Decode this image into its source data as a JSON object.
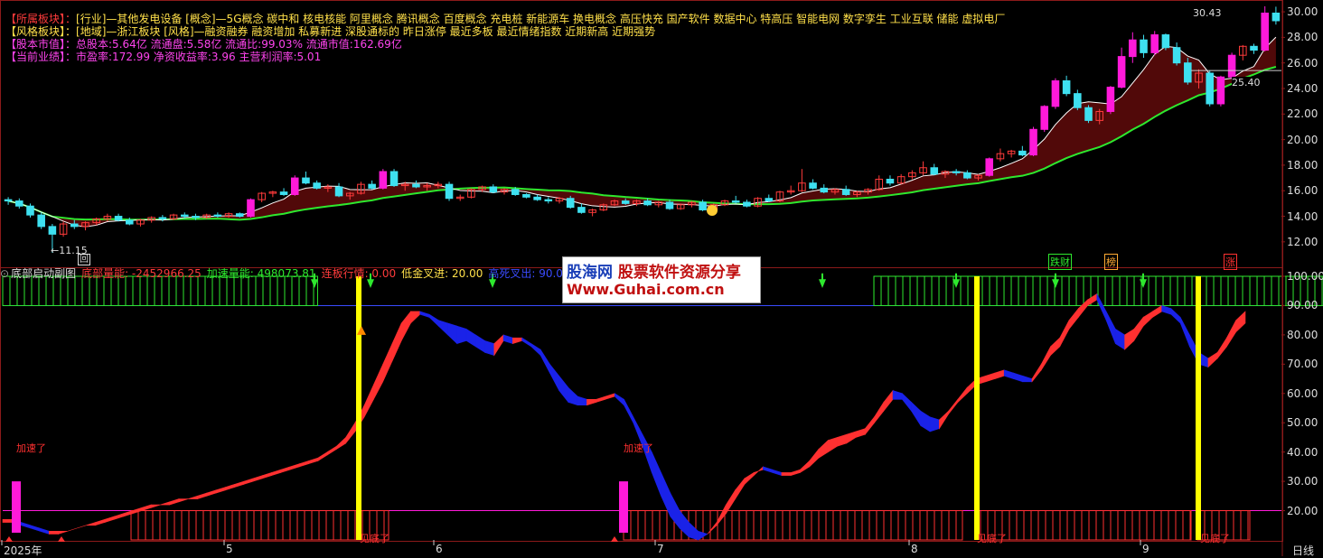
{
  "info": {
    "sector_key": "【所属板块】：",
    "sector_val": "[行业]—其他发电设备 [概念]—5G概念 碳中和 核电核能 阿里概念 腾讯概念 百度概念 充电桩 新能源车 换电概念 高压快充 国产软件 数据中心 特高压 智能电网 数字孪生 工业互联 储能 虚拟电厂",
    "style_key": "【风格板块】：",
    "style_val": "[地域]—浙江板块 [风格]—融资融券 融资增加 私募新进 深股通标的 昨日涨停 最近多板 最近情绪指数 近期新高 近期强势",
    "equity_key": "【股本市值】：",
    "equity_val": "总股本:5.64亿 流通盘:5.58亿 流通比:99.03% 流通市值:162.69亿",
    "perf_key": "【当前业绩】：",
    "perf_val": "市盈率:172.99 净资收益率:3.96 主营利润率:5.01"
  },
  "colors": {
    "up": "#ff3b3b",
    "down": "#3ee0f0",
    "magenta": "#ff1ad9",
    "green_line": "#2ee82e",
    "white_line": "#ffffff",
    "fill_red": "#5a0a0a",
    "fill_green": "#0f5a1a",
    "grid": "#8b1a1a",
    "osc_red": "#ff3030",
    "osc_blue": "#1a22e8",
    "yellow": "#ffff00"
  },
  "main_axis": {
    "labels": [
      "30.00",
      "28.00",
      "26.00",
      "24.00",
      "22.00",
      "20.00",
      "18.00",
      "16.00",
      "14.00",
      "12.00"
    ]
  },
  "main_annotations": {
    "high": "30.43",
    "low": "←11.15",
    "last": "25.40",
    "box": "回"
  },
  "badges": [
    {
      "label": "跌财",
      "color": "#2ee82e"
    },
    {
      "label": "榜",
      "color": "#ffaa33"
    },
    {
      "label": "涨",
      "color": "#ff3030"
    }
  ],
  "indicator_header": {
    "name": "底部启动副图",
    "energy": "底部量能: -2452966.25",
    "accel": "加速量能: 498073.81",
    "board": "连板行情: 0.00",
    "golden": "低金叉进: 20.00",
    "cross": "高死叉出: 90.00"
  },
  "sub_axis": {
    "labels": [
      "100.00",
      "90.00",
      "80.00",
      "70.00",
      "60.00",
      "50.00",
      "40.00",
      "30.00",
      "20.00"
    ]
  },
  "sub_labels": {
    "accel": "加速了",
    "bottom": "见底了"
  },
  "x_labels": [
    "2025年",
    "5",
    "6",
    "7",
    "8",
    "9"
  ],
  "period": "日线",
  "watermark": {
    "brand": "股海网",
    "slogan": "股票软件资源分享",
    "url": "Www.Guhai.com.cn"
  },
  "chart_data": {
    "type": "candlestick",
    "title": "",
    "ylim": [
      11,
      30.5
    ],
    "candles": [
      [
        15.3,
        15.5,
        14.9,
        15.2
      ],
      [
        15.2,
        15.4,
        14.6,
        14.8
      ],
      [
        14.8,
        15.0,
        13.9,
        14.1
      ],
      [
        14.1,
        14.3,
        13.0,
        13.2
      ],
      [
        13.2,
        13.4,
        11.15,
        12.6
      ],
      [
        12.6,
        13.6,
        12.4,
        13.4
      ],
      [
        13.4,
        13.7,
        13.0,
        13.2
      ],
      [
        13.2,
        13.6,
        12.9,
        13.5
      ],
      [
        13.5,
        13.9,
        13.3,
        13.8
      ],
      [
        13.8,
        14.2,
        13.6,
        14.0
      ],
      [
        14.0,
        14.2,
        13.6,
        13.7
      ],
      [
        13.7,
        13.9,
        13.3,
        13.4
      ],
      [
        13.4,
        13.8,
        13.2,
        13.7
      ],
      [
        13.7,
        14.0,
        13.5,
        13.9
      ],
      [
        13.9,
        14.1,
        13.6,
        13.8
      ],
      [
        13.8,
        14.2,
        13.7,
        14.1
      ],
      [
        14.1,
        14.3,
        13.8,
        14.0
      ],
      [
        14.0,
        14.2,
        13.7,
        13.9
      ],
      [
        13.9,
        14.2,
        13.8,
        14.1
      ],
      [
        14.1,
        14.3,
        13.9,
        14.0
      ],
      [
        14.0,
        14.3,
        13.9,
        14.2
      ],
      [
        14.2,
        14.3,
        13.9,
        14.0
      ],
      [
        14.0,
        15.4,
        13.9,
        15.3
      ],
      [
        15.3,
        15.9,
        15.1,
        15.8
      ],
      [
        15.8,
        16.0,
        15.5,
        15.9
      ],
      [
        15.9,
        16.2,
        15.6,
        15.7
      ],
      [
        15.7,
        17.2,
        15.6,
        17.0
      ],
      [
        17.0,
        17.5,
        16.5,
        16.6
      ],
      [
        16.6,
        16.8,
        16.1,
        16.2
      ],
      [
        16.2,
        16.5,
        15.9,
        16.3
      ],
      [
        16.3,
        16.6,
        15.5,
        15.6
      ],
      [
        15.6,
        15.9,
        15.3,
        15.8
      ],
      [
        15.8,
        16.7,
        15.7,
        16.5
      ],
      [
        16.5,
        16.8,
        16.1,
        16.2
      ],
      [
        16.2,
        17.7,
        16.1,
        17.5
      ],
      [
        17.5,
        17.7,
        16.3,
        16.4
      ],
      [
        16.4,
        16.7,
        16.0,
        16.5
      ],
      [
        16.5,
        16.8,
        16.2,
        16.3
      ],
      [
        16.3,
        16.6,
        16.0,
        16.4
      ],
      [
        16.4,
        16.7,
        16.2,
        16.5
      ],
      [
        16.5,
        16.7,
        15.2,
        15.4
      ],
      [
        15.4,
        15.7,
        15.2,
        15.5
      ],
      [
        15.5,
        16.2,
        15.4,
        16.1
      ],
      [
        16.1,
        16.4,
        15.9,
        16.3
      ],
      [
        16.3,
        16.5,
        15.8,
        15.9
      ],
      [
        15.9,
        16.2,
        15.7,
        16.1
      ],
      [
        16.1,
        16.3,
        15.6,
        15.7
      ],
      [
        15.7,
        15.8,
        15.4,
        15.5
      ],
      [
        15.5,
        15.7,
        15.2,
        15.3
      ],
      [
        15.3,
        15.5,
        15.0,
        15.2
      ],
      [
        15.2,
        15.5,
        15.0,
        15.4
      ],
      [
        15.4,
        15.6,
        14.6,
        14.7
      ],
      [
        14.7,
        15.0,
        14.2,
        14.3
      ],
      [
        14.3,
        14.6,
        14.0,
        14.5
      ],
      [
        14.5,
        15.0,
        14.4,
        14.9
      ],
      [
        14.9,
        15.3,
        14.8,
        15.2
      ],
      [
        15.2,
        15.4,
        14.9,
        15.0
      ],
      [
        15.0,
        15.3,
        14.8,
        15.2
      ],
      [
        15.2,
        15.4,
        14.8,
        14.9
      ],
      [
        14.9,
        15.2,
        14.7,
        15.1
      ],
      [
        15.1,
        15.3,
        14.5,
        14.6
      ],
      [
        14.6,
        15.0,
        14.5,
        14.9
      ],
      [
        14.9,
        15.2,
        14.7,
        15.1
      ],
      [
        15.1,
        15.3,
        14.4,
        14.5
      ],
      [
        14.5,
        15.0,
        14.4,
        14.9
      ],
      [
        14.9,
        15.3,
        14.8,
        15.2
      ],
      [
        15.2,
        15.6,
        15.0,
        15.1
      ],
      [
        15.1,
        15.3,
        14.7,
        14.8
      ],
      [
        14.8,
        15.5,
        14.7,
        15.4
      ],
      [
        15.4,
        15.7,
        15.1,
        15.2
      ],
      [
        15.2,
        16.0,
        15.1,
        15.9
      ],
      [
        15.9,
        16.4,
        15.7,
        16.0
      ],
      [
        16.0,
        17.7,
        15.9,
        16.6
      ],
      [
        16.6,
        16.9,
        16.1,
        16.2
      ],
      [
        16.2,
        16.5,
        15.8,
        15.9
      ],
      [
        15.9,
        16.2,
        15.7,
        16.1
      ],
      [
        16.1,
        16.4,
        15.6,
        15.7
      ],
      [
        15.7,
        16.0,
        15.5,
        15.9
      ],
      [
        15.9,
        16.2,
        15.7,
        16.1
      ],
      [
        16.1,
        17.2,
        16.0,
        16.9
      ],
      [
        16.9,
        17.2,
        16.4,
        16.6
      ],
      [
        16.6,
        17.3,
        16.5,
        17.1
      ],
      [
        17.1,
        17.6,
        16.9,
        17.4
      ],
      [
        17.4,
        18.3,
        17.2,
        17.8
      ],
      [
        17.8,
        18.1,
        17.2,
        17.3
      ],
      [
        17.3,
        17.6,
        17.0,
        17.5
      ],
      [
        17.5,
        17.7,
        17.2,
        17.4
      ],
      [
        17.4,
        17.6,
        16.9,
        17.0
      ],
      [
        17.0,
        17.3,
        16.8,
        17.2
      ],
      [
        17.2,
        18.6,
        17.1,
        18.5
      ],
      [
        18.5,
        19.3,
        18.3,
        18.9
      ],
      [
        18.9,
        19.2,
        18.6,
        19.1
      ],
      [
        19.1,
        19.5,
        18.7,
        18.8
      ],
      [
        18.8,
        21.0,
        18.7,
        20.8
      ],
      [
        20.8,
        22.7,
        20.6,
        22.6
      ],
      [
        22.6,
        24.8,
        22.4,
        24.6
      ],
      [
        24.6,
        25.0,
        23.4,
        23.6
      ],
      [
        23.6,
        23.9,
        22.3,
        22.5
      ],
      [
        22.5,
        22.7,
        21.3,
        21.5
      ],
      [
        21.5,
        22.4,
        21.2,
        22.2
      ],
      [
        22.2,
        24.2,
        22.0,
        24.1
      ],
      [
        24.1,
        27.2,
        24.0,
        26.5
      ],
      [
        26.5,
        28.4,
        26.0,
        27.8
      ],
      [
        27.8,
        28.2,
        26.4,
        26.8
      ],
      [
        26.8,
        28.5,
        26.6,
        28.2
      ],
      [
        28.2,
        28.3,
        27.0,
        27.2
      ],
      [
        27.2,
        27.6,
        25.8,
        26.0
      ],
      [
        26.0,
        26.4,
        24.3,
        24.5
      ],
      [
        24.5,
        25.5,
        24.0,
        25.2
      ],
      [
        25.2,
        25.4,
        22.6,
        22.8
      ],
      [
        22.8,
        25.0,
        22.6,
        24.9
      ],
      [
        24.9,
        26.8,
        24.7,
        26.6
      ],
      [
        26.6,
        27.4,
        26.2,
        27.3
      ],
      [
        27.3,
        27.5,
        26.7,
        27.0
      ],
      [
        27.0,
        30.43,
        26.9,
        29.9
      ],
      [
        29.9,
        30.4,
        29.0,
        29.3
      ]
    ],
    "osc_a": [
      16,
      16,
      15,
      14,
      13,
      12,
      12,
      13,
      14,
      15,
      16,
      17,
      18,
      19,
      20,
      21,
      22,
      22,
      23,
      24,
      24,
      25,
      26,
      27,
      28,
      29,
      30,
      31,
      32,
      33,
      34,
      35,
      36,
      37,
      38,
      40,
      42,
      45,
      50,
      56,
      63,
      70,
      77,
      84,
      88,
      88,
      87,
      85,
      84,
      83,
      82,
      80,
      78,
      77,
      80,
      79,
      79,
      77,
      75,
      70,
      66,
      62,
      59,
      58,
      58,
      59,
      60,
      58,
      52,
      46,
      40,
      33,
      26,
      20,
      16,
      13,
      12,
      15,
      19,
      24,
      29,
      32,
      35,
      34,
      33,
      33,
      34,
      37,
      41,
      44,
      45,
      46,
      47,
      48,
      52,
      57,
      61,
      60,
      57,
      54,
      52,
      51,
      54,
      58,
      62,
      65,
      66,
      67,
      68,
      67,
      66,
      65,
      70,
      76,
      79,
      85,
      89,
      92,
      94,
      88,
      82,
      80,
      82,
      86,
      88,
      90,
      89,
      86,
      80,
      74,
      72,
      74,
      79,
      85,
      88
    ],
    "osc_b": [
      17,
      17,
      16,
      15,
      14,
      13,
      13,
      13,
      14,
      15,
      15,
      16,
      17,
      18,
      19,
      20,
      21,
      22,
      22,
      23,
      24,
      24,
      25,
      26,
      27,
      28,
      29,
      30,
      31,
      32,
      33,
      34,
      35,
      36,
      37,
      39,
      41,
      43,
      47,
      52,
      58,
      64,
      71,
      78,
      84,
      87,
      86,
      83,
      80,
      77,
      78,
      76,
      74,
      73,
      78,
      77,
      78,
      76,
      73,
      67,
      61,
      57,
      56,
      56,
      57,
      58,
      59,
      56,
      50,
      42,
      33,
      25,
      18,
      14,
      11,
      10,
      12,
      16,
      22,
      27,
      31,
      33,
      34,
      33,
      32,
      32,
      33,
      35,
      38,
      40,
      42,
      43,
      45,
      46,
      50,
      54,
      58,
      58,
      54,
      49,
      47,
      48,
      53,
      57,
      60,
      63,
      64,
      65,
      66,
      65,
      64,
      64,
      68,
      73,
      76,
      82,
      86,
      90,
      92,
      85,
      77,
      75,
      78,
      83,
      86,
      88,
      87,
      84,
      76,
      70,
      69,
      72,
      76,
      81,
      84
    ]
  }
}
